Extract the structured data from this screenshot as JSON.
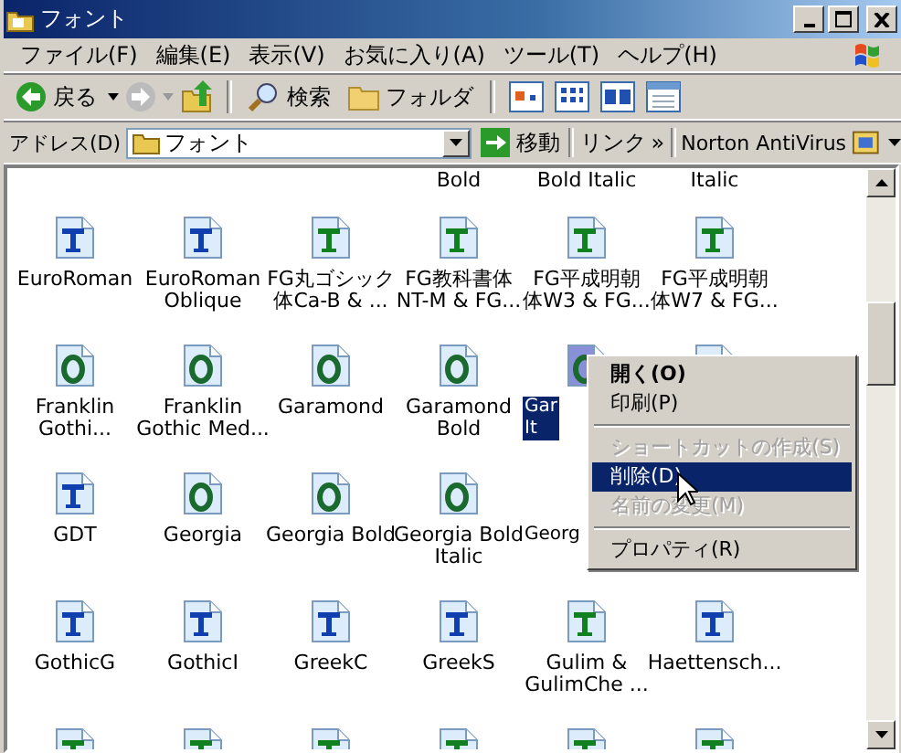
{
  "window": {
    "title": "フォント"
  },
  "menu": [
    "ファイル(F)",
    "編集(E)",
    "表示(V)",
    "お気に入り(A)",
    "ツール(T)",
    "ヘルプ(H)"
  ],
  "toolbar": {
    "back": "戻る",
    "search": "検索",
    "folders": "フォルダ"
  },
  "address": {
    "label": "アドレス(D)",
    "value": "フォント",
    "go": "移動",
    "links": "リンク",
    "chevron": "»",
    "norton": "Norton AntiVirus"
  },
  "rows": [
    [
      {
        "kind": "none"
      },
      {
        "kind": "none"
      },
      {
        "kind": "none"
      },
      {
        "kind": "none",
        "lines": [
          "Bold"
        ]
      },
      {
        "kind": "none",
        "lines": [
          "Bold Italic"
        ]
      },
      {
        "kind": "none",
        "lines": [
          "Italic"
        ]
      }
    ],
    [
      {
        "kind": "truetype",
        "lines": [
          "EuroRoman"
        ],
        "selected": false
      },
      {
        "kind": "truetype",
        "lines": [
          "EuroRoman",
          "Oblique"
        ],
        "selected": false
      },
      {
        "kind": "truetype-green",
        "lines": [
          "FG丸ゴシック",
          "体Ca-B & ..."
        ],
        "selected": false
      },
      {
        "kind": "truetype-green",
        "lines": [
          "FG教科書体",
          "NT-M & FG..."
        ],
        "selected": false
      },
      {
        "kind": "truetype-green",
        "lines": [
          "FG平成明朝",
          "体W3 & FG..."
        ],
        "selected": false
      },
      {
        "kind": "truetype-green",
        "lines": [
          "FG平成明朝",
          "体W7 & FG..."
        ],
        "selected": false
      }
    ],
    [
      {
        "kind": "opentype",
        "lines": [
          "Franklin",
          "Gothi..."
        ],
        "selected": false
      },
      {
        "kind": "opentype",
        "lines": [
          "Franklin",
          "Gothic Med..."
        ],
        "selected": false
      },
      {
        "kind": "opentype",
        "lines": [
          "Garamond"
        ],
        "selected": false
      },
      {
        "kind": "opentype",
        "lines": [
          "Garamond",
          "Bold"
        ],
        "selected": false
      },
      {
        "kind": "opentype",
        "lines": [
          "Gar",
          "It"
        ],
        "selected": true,
        "clipped": true
      },
      {
        "kind": "opentype",
        "selected": false
      }
    ],
    [
      {
        "kind": "truetype",
        "lines": [
          "GDT"
        ],
        "selected": false
      },
      {
        "kind": "opentype",
        "lines": [
          "Georgia"
        ],
        "selected": false
      },
      {
        "kind": "opentype",
        "lines": [
          "Georgia Bold"
        ],
        "selected": false
      },
      {
        "kind": "opentype",
        "lines": [
          "Georgia Bold",
          "Italic"
        ],
        "selected": false
      },
      {
        "kind": "none",
        "lines": [
          "Georg"
        ],
        "selected": false,
        "clipped": true
      },
      {
        "kind": "none"
      }
    ],
    [
      {
        "kind": "truetype",
        "lines": [
          "GothicG"
        ],
        "selected": false
      },
      {
        "kind": "truetype",
        "lines": [
          "GothicI"
        ],
        "selected": false
      },
      {
        "kind": "truetype",
        "lines": [
          "GreekC"
        ],
        "selected": false
      },
      {
        "kind": "truetype",
        "lines": [
          "GreekS"
        ],
        "selected": false
      },
      {
        "kind": "truetype-green",
        "lines": [
          "Gulim &",
          "GulimChe ..."
        ],
        "selected": false
      },
      {
        "kind": "truetype",
        "lines": [
          "Haettensch..."
        ],
        "selected": false
      }
    ],
    [
      {
        "kind": "truetype-green",
        "selected": false
      },
      {
        "kind": "truetype-green",
        "selected": false
      },
      {
        "kind": "truetype-green",
        "selected": false
      },
      {
        "kind": "truetype-green",
        "selected": false
      },
      {
        "kind": "truetype-green",
        "selected": false
      },
      {
        "kind": "truetype-green",
        "selected": false
      }
    ]
  ],
  "context_menu": [
    {
      "kind": "item",
      "label": "開く(O)",
      "bold": true,
      "disabled": false,
      "selected": false
    },
    {
      "kind": "item",
      "label": "印刷(P)",
      "bold": false,
      "disabled": false,
      "selected": false
    },
    {
      "kind": "separator"
    },
    {
      "kind": "item",
      "label": "ショートカットの作成(S)",
      "bold": false,
      "disabled": true,
      "selected": false
    },
    {
      "kind": "item",
      "label": "削除(D)",
      "bold": false,
      "disabled": false,
      "selected": true
    },
    {
      "kind": "item",
      "label": "名前の変更(M)",
      "bold": false,
      "disabled": true,
      "selected": false
    },
    {
      "kind": "separator"
    },
    {
      "kind": "item",
      "label": "プロパティ(R)",
      "bold": false,
      "disabled": false,
      "selected": false
    }
  ]
}
